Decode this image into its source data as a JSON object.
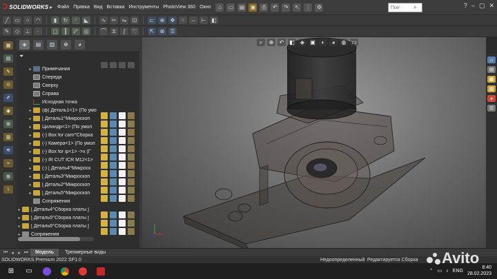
{
  "app": {
    "logo_text": "SOLIDWORKS",
    "menu": [
      "Файл",
      "Правка",
      "Вид",
      "Вставка",
      "Инструменты",
      "PhotoView 360",
      "Окно"
    ],
    "search_placeholder": "Пои"
  },
  "tree": {
    "items": [
      {
        "label": "Примечания",
        "icon": "note",
        "indent": "ind8",
        "exp": "▸"
      },
      {
        "label": "Спереди",
        "icon": "plane",
        "indent": "ind8",
        "exp": ""
      },
      {
        "label": "Сверху",
        "icon": "plane",
        "indent": "ind8",
        "exp": ""
      },
      {
        "label": "Справа",
        "icon": "plane",
        "indent": "ind8",
        "exp": ""
      },
      {
        "label": "Исходная точка",
        "icon": "origin",
        "indent": "ind8",
        "exp": ""
      },
      {
        "label": "(ф) Деталь1<1> (По умо",
        "icon": "part",
        "indent": "ind8",
        "exp": "▸"
      },
      {
        "label": "[ Деталь1^Микроскоп",
        "icon": "part",
        "indent": "ind8",
        "exp": "▸"
      },
      {
        "label": "Цилиндр<1> (По умол",
        "icon": "part",
        "indent": "ind8",
        "exp": "▸"
      },
      {
        "label": "(-) Box for cam^Сборка",
        "icon": "part",
        "indent": "ind8",
        "exp": "▸"
      },
      {
        "label": "(-) Камера<1> (По умол",
        "icon": "part",
        "indent": "ind8",
        "exp": "▸"
      },
      {
        "label": "(-) Box for ip<1> ->x (Г",
        "icon": "part",
        "indent": "ind8",
        "exp": "▸"
      },
      {
        "label": "(-) IR CUT ICR M12<1>",
        "icon": "part",
        "indent": "ind8",
        "exp": "▸"
      },
      {
        "label": "(-) [ Деталь4^Микроск",
        "icon": "part",
        "indent": "ind8",
        "exp": "▸"
      },
      {
        "label": "[ Деталь3^Микроскоп",
        "icon": "part",
        "indent": "ind8",
        "exp": "▸"
      },
      {
        "label": "[ Деталь2^Микроскоп",
        "icon": "part",
        "indent": "ind8",
        "exp": "▸"
      },
      {
        "label": "[ Деталь5^Микроскоп",
        "icon": "part",
        "indent": "ind8",
        "exp": "▸"
      },
      {
        "label": "Сопряжения",
        "icon": "mate",
        "indent": "ind8",
        "exp": ""
      },
      {
        "label": "[ Деталь4^Сборка платы ]",
        "icon": "part",
        "indent": "ind0",
        "exp": "▸"
      },
      {
        "label": "[ Деталь5^Сборка платы ]",
        "icon": "part",
        "indent": "ind0",
        "exp": "▸"
      },
      {
        "label": "[ Деталь6^Сборка платы ]",
        "icon": "part",
        "indent": "ind0",
        "exp": "▸"
      },
      {
        "label": "Сопряжения",
        "icon": "mate",
        "indent": "ind0",
        "exp": "▸"
      }
    ]
  },
  "bottom_tabs": {
    "model": "Модель",
    "views3d": "Трехмерные виды"
  },
  "status": {
    "left": "SOLIDWORKS Premium 2022 SP1.0",
    "underdefined": "Недоопределенный",
    "editing": "Редактируется Сборка"
  },
  "taskbar": {
    "lang": "ENG",
    "date": "28.02.2023",
    "time": "8:40"
  },
  "watermark": "Avito"
}
